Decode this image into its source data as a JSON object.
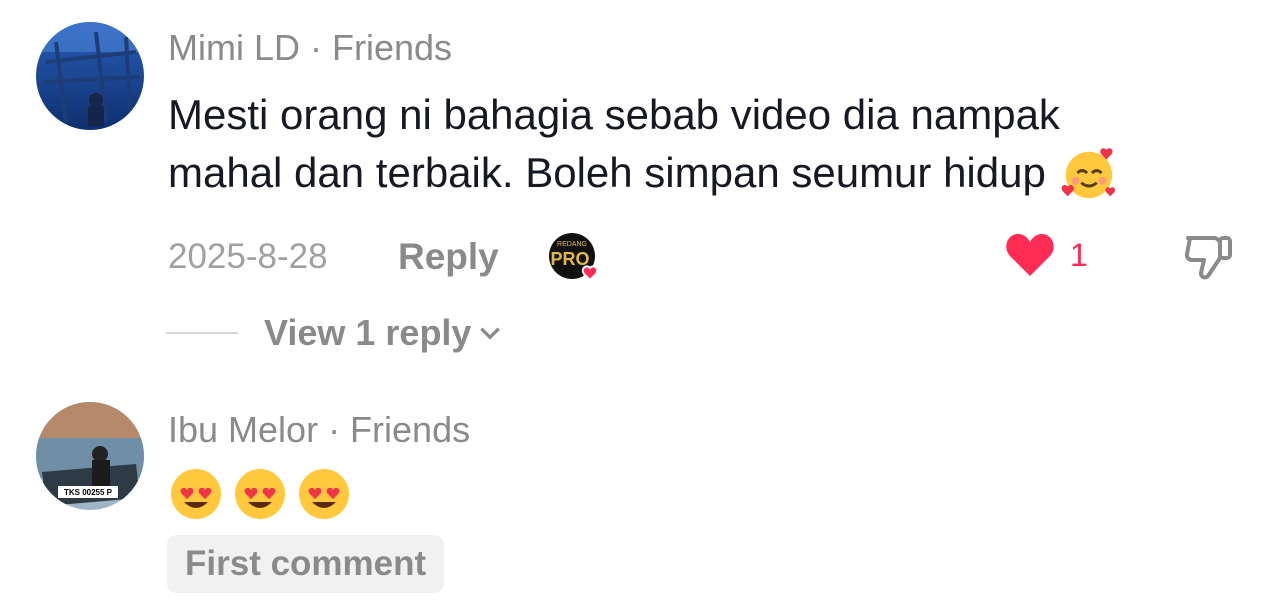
{
  "comments": [
    {
      "author": "Mimi LD · Friends",
      "text_line1": "Mesti orang ni bahagia sebab video dia nampak",
      "text_line2": "mahal dan terbaik. Boleh simpan seumur hidup",
      "trailing_emoji": "smiling-face-with-hearts",
      "date": "2025-8-28",
      "reply_label": "Reply",
      "creator_badge_text": "REDANG",
      "like_count": "1",
      "view_replies_label": "View 1 reply"
    },
    {
      "author": "Ibu Melor · Friends",
      "emojis": [
        "heart-eyes",
        "heart-eyes",
        "heart-eyes"
      ],
      "avatar_plate_text": "TKS 00255 P",
      "badge_label": "First comment"
    }
  ],
  "colors": {
    "like": "#fe2c55",
    "muted_text": "#8a8a8a",
    "primary_text": "#161823",
    "badge_bg": "#f1f1f2"
  }
}
